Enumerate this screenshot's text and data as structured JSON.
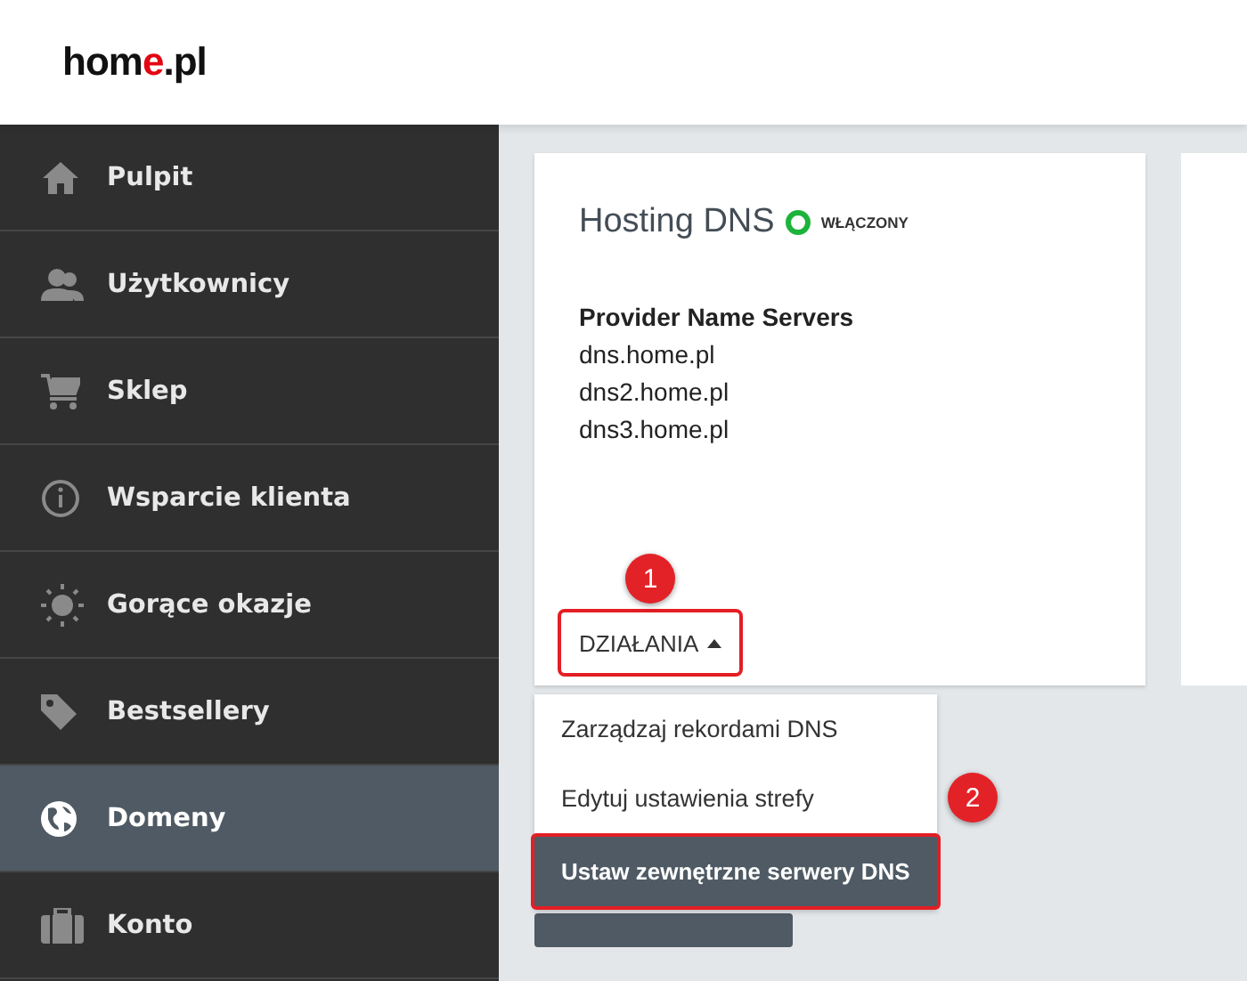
{
  "logo": {
    "parts": [
      {
        "text": "hom",
        "accent": false
      },
      {
        "text": "e",
        "accent": true
      },
      {
        "text": ".pl",
        "accent": false
      }
    ]
  },
  "sidebar": {
    "items": [
      {
        "label": "Pulpit",
        "selected": false
      },
      {
        "label": "Użytkownicy",
        "selected": false
      },
      {
        "label": "Sklep",
        "selected": false
      },
      {
        "label": "Wsparcie klienta",
        "selected": false
      },
      {
        "label": "Gorące okazje",
        "selected": false
      },
      {
        "label": "Bestsellery",
        "selected": false
      },
      {
        "label": "Domeny",
        "selected": true
      },
      {
        "label": "Konto",
        "selected": false
      }
    ]
  },
  "card": {
    "title": "Hosting DNS",
    "status": {
      "label": "WŁĄCZONY",
      "on": true
    },
    "section_title": "Provider Name Servers",
    "servers": [
      "dns.home.pl",
      "dns2.home.pl",
      "dns3.home.pl"
    ],
    "actions_button": {
      "label": "DZIAŁANIA",
      "expanded": true,
      "step": "1"
    }
  },
  "menu": {
    "items": [
      {
        "label": "Zarządzaj rekordami DNS",
        "selected": false
      },
      {
        "label": "Edytuj ustawienia strefy",
        "selected": false,
        "step": "2"
      },
      {
        "label": "Ustaw zewnętrzne serwery DNS",
        "selected": true
      }
    ]
  }
}
